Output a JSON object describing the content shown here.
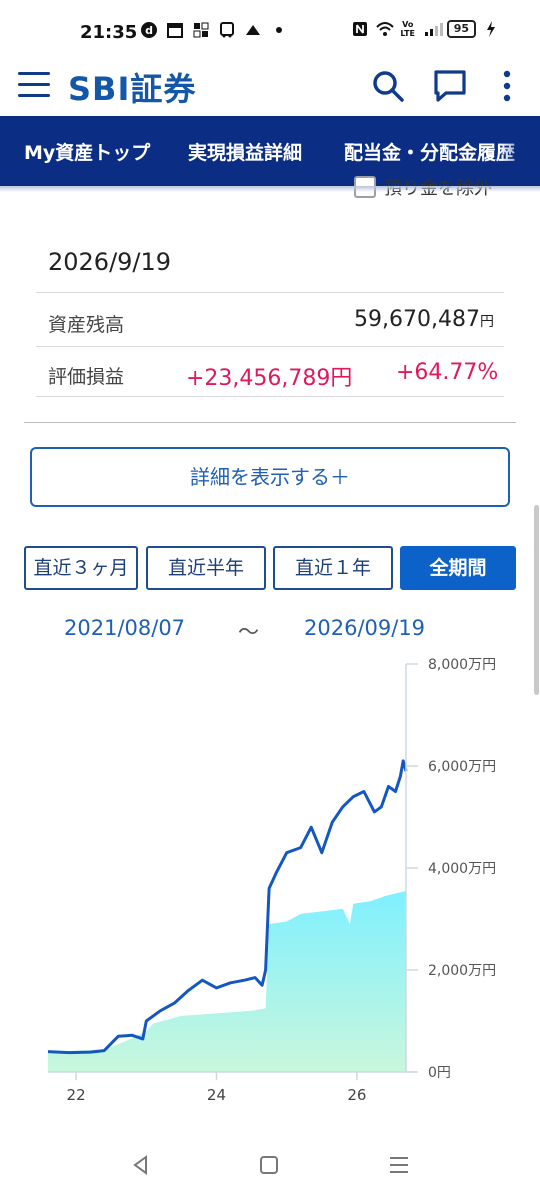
{
  "status": {
    "time": "21:35",
    "battery": "95",
    "left_icons": [
      "d-icon",
      "calendar-icon",
      "grid-icon",
      "bus-icon",
      "cloud-icon",
      "dot-icon"
    ],
    "right_icons": [
      "nfc-icon",
      "wifi-icon",
      "volte-icon",
      "signal-icon",
      "charging-icon"
    ]
  },
  "appbar": {
    "logo": "SBI証券"
  },
  "nav": {
    "tabs": [
      "My資産トップ",
      "実現損益詳細",
      "配当金・分配金履歴"
    ]
  },
  "filter": {
    "label": "預り金を除外"
  },
  "summary": {
    "date": "2026/9/19",
    "balance_label": "資産残高",
    "balance_value": "59,670,487",
    "balance_unit": "円",
    "pl_label": "評価損益",
    "pl_value": "+23,456,789円",
    "pl_percent": "+64.77%"
  },
  "detail_button": "詳細を表示する＋",
  "periods": [
    "直近３ヶ月",
    "直近半年",
    "直近１年",
    "全期間"
  ],
  "active_period": "全期間",
  "range": {
    "start": "2021/08/07",
    "sep": "〜",
    "end": "2026/09/19"
  },
  "chart_data": {
    "type": "area",
    "x_ticks": [
      "22",
      "24",
      "26"
    ],
    "y_ticks": [
      "0円",
      "2,000万円",
      "4,000万円",
      "6,000万円",
      "8,000万円"
    ],
    "ylim": [
      0,
      8000
    ],
    "y_unit": "万円",
    "series": [
      {
        "kind": "area",
        "x": [
          2021.6,
          2022.0,
          2022.4,
          2022.7,
          2023.0,
          2023.1,
          2023.5,
          2024.0,
          2024.5,
          2024.7,
          2024.75,
          2025.0,
          2025.2,
          2025.5,
          2025.8,
          2025.9,
          2025.95,
          2026.2,
          2026.4,
          2026.7
        ],
        "y": [
          400,
          420,
          440,
          600,
          800,
          950,
          1100,
          1150,
          1200,
          1250,
          2900,
          2950,
          3100,
          3150,
          3200,
          2900,
          3300,
          3350,
          3450,
          3550
        ]
      },
      {
        "kind": "line",
        "x": [
          2021.6,
          2021.9,
          2022.2,
          2022.4,
          2022.6,
          2022.8,
          2022.95,
          2023.0,
          2023.2,
          2023.4,
          2023.6,
          2023.8,
          2024.0,
          2024.2,
          2024.4,
          2024.55,
          2024.65,
          2024.7,
          2024.75,
          2024.85,
          2025.0,
          2025.2,
          2025.35,
          2025.5,
          2025.65,
          2025.8,
          2025.95,
          2026.1,
          2026.25,
          2026.35,
          2026.45,
          2026.55,
          2026.62,
          2026.66,
          2026.7
        ],
        "y": [
          400,
          380,
          390,
          420,
          700,
          720,
          650,
          1000,
          1200,
          1350,
          1600,
          1800,
          1650,
          1750,
          1800,
          1850,
          1700,
          2000,
          3600,
          3900,
          4300,
          4400,
          4800,
          4300,
          4900,
          5200,
          5400,
          5500,
          5100,
          5200,
          5600,
          5500,
          5800,
          6100,
          5900
        ]
      }
    ]
  },
  "sysnav": [
    "back-icon",
    "home-icon",
    "recents-icon"
  ]
}
